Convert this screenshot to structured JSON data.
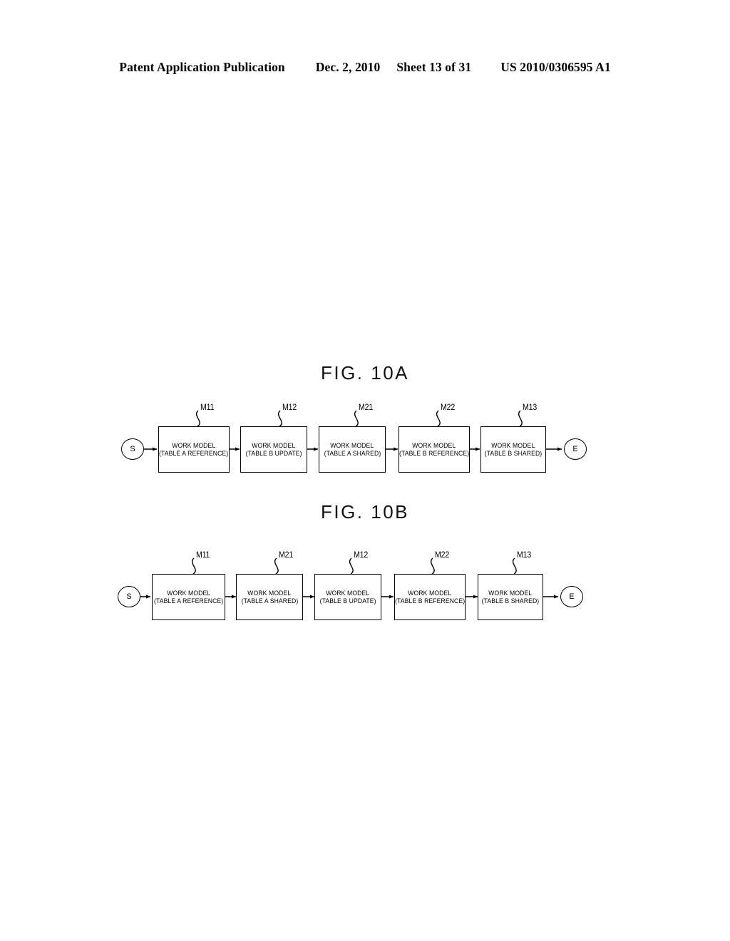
{
  "header": {
    "publication": "Patent Application Publication",
    "date": "Dec. 2, 2010",
    "sheet": "Sheet 13 of 31",
    "patent_number": "US 2010/0306595 A1"
  },
  "figures": [
    {
      "id": "fig-10a",
      "title": "FIG. 10A",
      "start_label": "S",
      "end_label": "E",
      "nodes": [
        {
          "ref": "M11",
          "line1": "WORK MODEL",
          "line2": "(TABLE A REFERENCE)"
        },
        {
          "ref": "M12",
          "line1": "WORK MODEL",
          "line2": "(TABLE B UPDATE)"
        },
        {
          "ref": "M21",
          "line1": "WORK MODEL",
          "line2": "(TABLE A SHARED)"
        },
        {
          "ref": "M22",
          "line1": "WORK MODEL",
          "line2": "(TABLE B REFERENCE)"
        },
        {
          "ref": "M13",
          "line1": "WORK MODEL",
          "line2": "(TABLE B SHARED)"
        }
      ]
    },
    {
      "id": "fig-10b",
      "title": "FIG. 10B",
      "start_label": "S",
      "end_label": "E",
      "nodes": [
        {
          "ref": "M11",
          "line1": "WORK MODEL",
          "line2": "(TABLE A REFERENCE)"
        },
        {
          "ref": "M21",
          "line1": "WORK MODEL",
          "line2": "(TABLE A SHARED)"
        },
        {
          "ref": "M12",
          "line1": "WORK MODEL",
          "line2": "(TABLE B UPDATE)"
        },
        {
          "ref": "M22",
          "line1": "WORK MODEL",
          "line2": "(TABLE B REFERENCE)"
        },
        {
          "ref": "M13",
          "line1": "WORK MODEL",
          "line2": "(TABLE B SHARED)"
        }
      ]
    }
  ],
  "colors": {
    "ink": "#000000",
    "paper": "#ffffff"
  }
}
